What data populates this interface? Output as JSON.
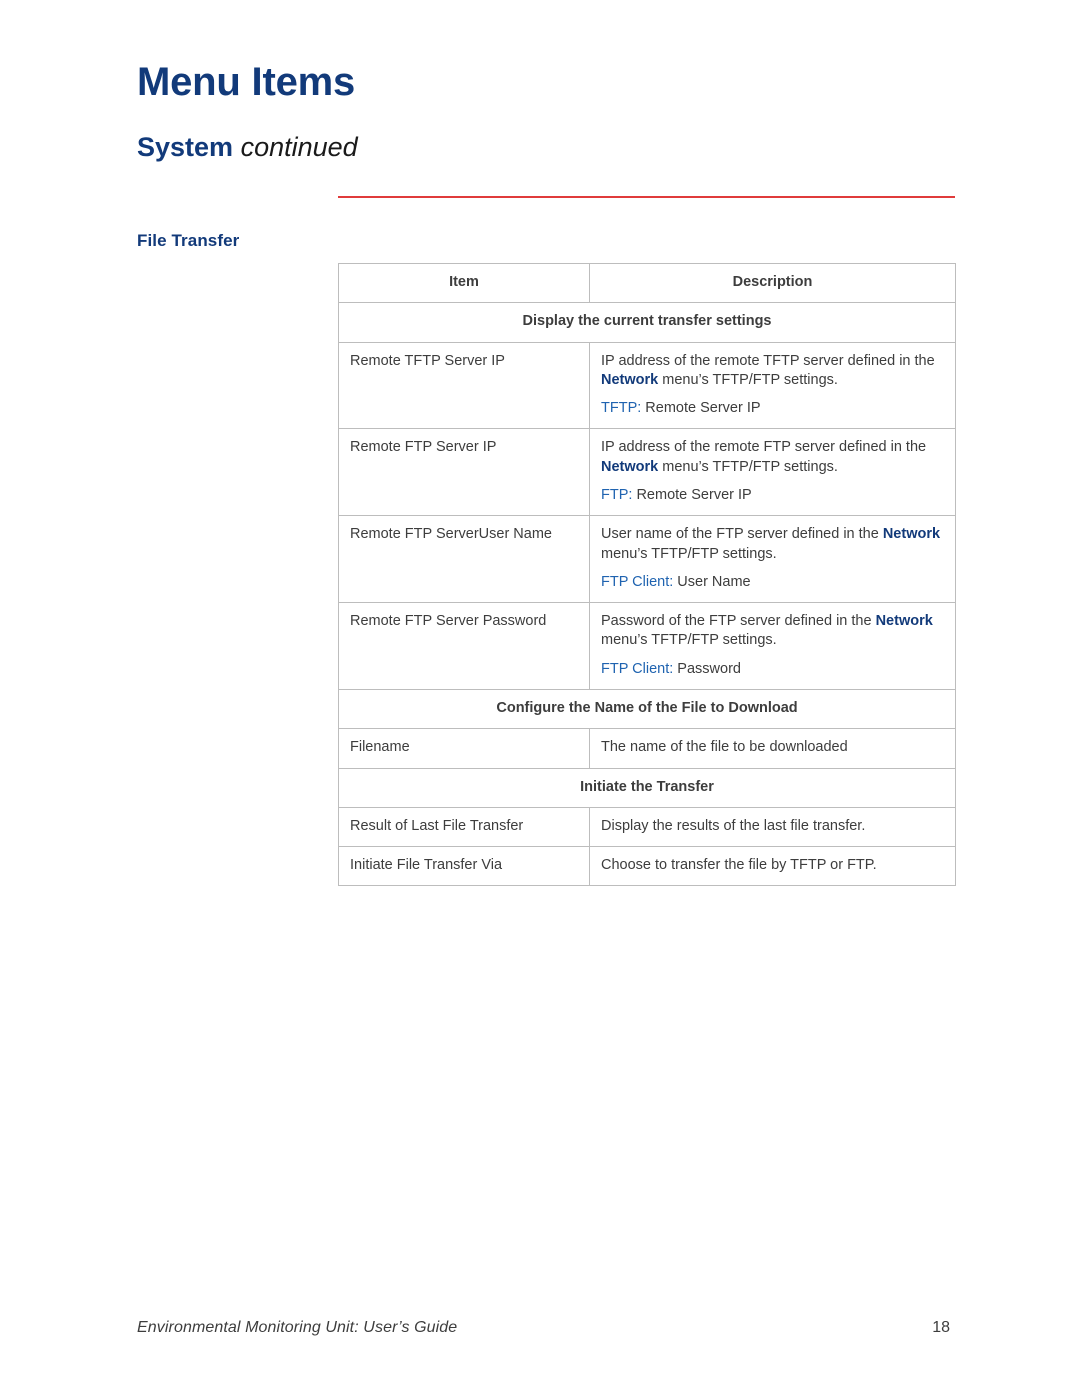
{
  "header": {
    "doc_title": "Menu Items",
    "section_name": "System",
    "section_state": "continued"
  },
  "side_label": "File Transfer",
  "colors": {
    "navy": "#123A7A",
    "link_blue": "#1F63B0",
    "rule_red": "#E03B3B",
    "border_gray": "#bdbdbd",
    "body_text": "#3d3d3d"
  },
  "table": {
    "columns": [
      {
        "header": "Item"
      },
      {
        "header": "Description"
      }
    ],
    "sections": [
      {
        "title": "Display the current transfer settings",
        "rows": [
          {
            "item": "Remote TFTP Server IP",
            "desc_pre": "IP address of the remote TFTP server defined in the ",
            "desc_bold": "Network",
            "desc_post": " menu’s TFTP/FTP settings.",
            "path_label": "TFTP:",
            "path_value": " Remote Server IP"
          },
          {
            "item": "Remote FTP Server IP",
            "desc_pre": "IP address of the remote FTP server defined in the ",
            "desc_bold": "Network",
            "desc_post": " menu’s TFTP/FTP settings.",
            "path_label": "FTP:",
            "path_value": " Remote Server IP"
          },
          {
            "item": "Remote FTP ServerUser Name",
            "desc_pre": "User name of the FTP server defined in the ",
            "desc_bold": "Network",
            "desc_post": " menu’s TFTP/FTP settings.",
            "path_label": "FTP Client:",
            "path_value": " User Name"
          },
          {
            "item": "Remote FTP Server Password",
            "desc_pre": "Password of the FTP server defined in the ",
            "desc_bold": "Network",
            "desc_post": " menu’s TFTP/FTP settings.",
            "path_label": "FTP Client:",
            "path_value": " Password"
          }
        ]
      },
      {
        "title": "Configure the Name of the File to Download",
        "rows": [
          {
            "item": "Filename",
            "desc_pre": "The name of the file to be downloaded",
            "desc_bold": "",
            "desc_post": "",
            "path_label": "",
            "path_value": ""
          }
        ]
      },
      {
        "title": "Initiate the Transfer",
        "rows": [
          {
            "item": "Result of Last File Transfer",
            "desc_pre": "Display the results of the last file transfer.",
            "desc_bold": "",
            "desc_post": "",
            "path_label": "",
            "path_value": ""
          },
          {
            "item": "Initiate File Transfer Via",
            "desc_pre": "Choose to transfer the file by TFTP or FTP.",
            "desc_bold": "",
            "desc_post": "",
            "path_label": "",
            "path_value": ""
          }
        ]
      }
    ]
  },
  "footer": {
    "text": "Environmental Monitoring Unit: User’s Guide",
    "page_number": "18"
  }
}
